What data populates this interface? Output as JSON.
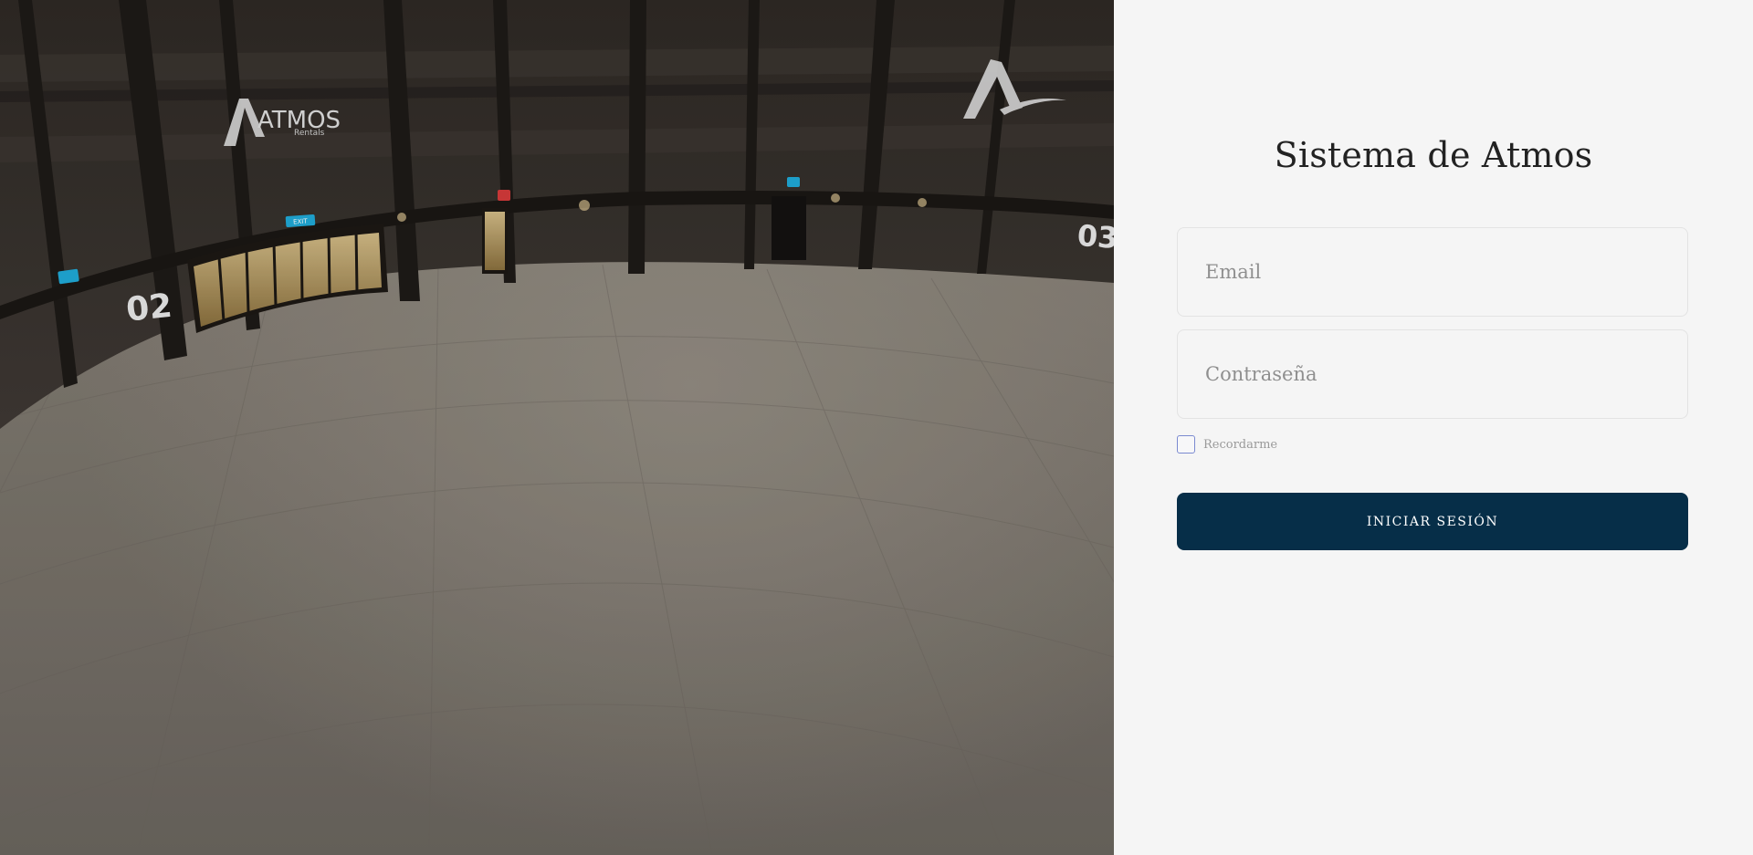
{
  "hero": {
    "logo_left_text": "ATMOS",
    "logo_left_sub": "Rentals",
    "wall_number_left": "02",
    "wall_number_right": "03",
    "exit_sign": "EXIT"
  },
  "login": {
    "title": "Sistema de Atmos",
    "email_placeholder": "Email",
    "password_placeholder": "Contraseña",
    "remember_label": "Recordarme",
    "submit_label": "INICIAR SESIÓN"
  },
  "colors": {
    "button_bg": "#062e48",
    "panel_bg": "#f5f5f5",
    "checkbox_border": "#7a8ad0"
  }
}
